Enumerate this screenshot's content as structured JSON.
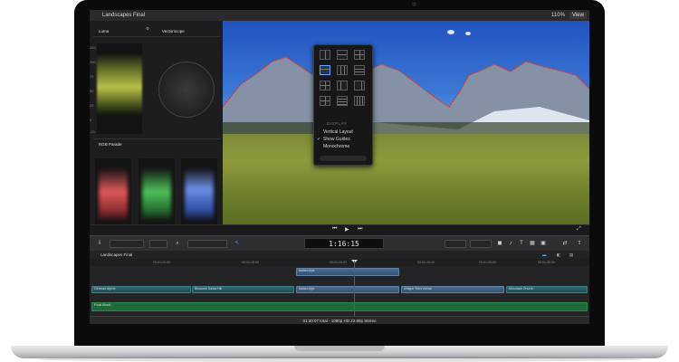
{
  "window": {
    "project_title": "Landscapes Final",
    "zoom_level": "110%",
    "view_label": "View"
  },
  "scopes": {
    "luma_label": "Luma",
    "vectorscope_label": "Vectorscope",
    "luma_scale": [
      "120",
      "100",
      "75",
      "50",
      "25",
      "0",
      "-20"
    ],
    "rgb_label": "RGB Parade",
    "rgb_channels": [
      {
        "label": "Red",
        "color": "#e0585a"
      },
      {
        "label": "Green",
        "color": "#4fc25b"
      },
      {
        "label": "Blue",
        "color": "#6b8fe8"
      }
    ]
  },
  "view_menu": {
    "title": "View",
    "section_header": "DISPLAY",
    "items": [
      {
        "label": "Vertical Layout",
        "checked": false
      },
      {
        "label": "Show Guides",
        "checked": true
      },
      {
        "label": "Monochrome",
        "checked": false
      }
    ]
  },
  "viewer": {
    "frame_colors": {
      "sky": "#2f66cc",
      "grass": "#8a963c"
    }
  },
  "transport": {
    "prev_icon": "skip-back-icon",
    "play_icon": "play-icon",
    "next_icon": "skip-forward-icon"
  },
  "toolbar": {
    "timecode": "1:16:15",
    "accent_color": "#5aa0ff"
  },
  "timeline": {
    "project_name": "Landscapes Final",
    "ruler_ticks": [
      "00:01:10:00",
      "00:01:15:00",
      "00:01:20:00",
      "00:01:25:00",
      "00:01:30:00",
      "00:01:35:00"
    ],
    "clips": [
      {
        "label": "German Alpine"
      },
      {
        "label": "Blossom Swiss Hill"
      },
      {
        "label": "Italian Alps"
      },
      {
        "label": "Italian Alps"
      },
      {
        "label": "Unique Terre Aerial"
      },
      {
        "label": "Mountain Church"
      }
    ],
    "music_label": "Float Music"
  },
  "status": {
    "text": "01:30:07 total - 1080p HD 23.98p Stereo"
  }
}
